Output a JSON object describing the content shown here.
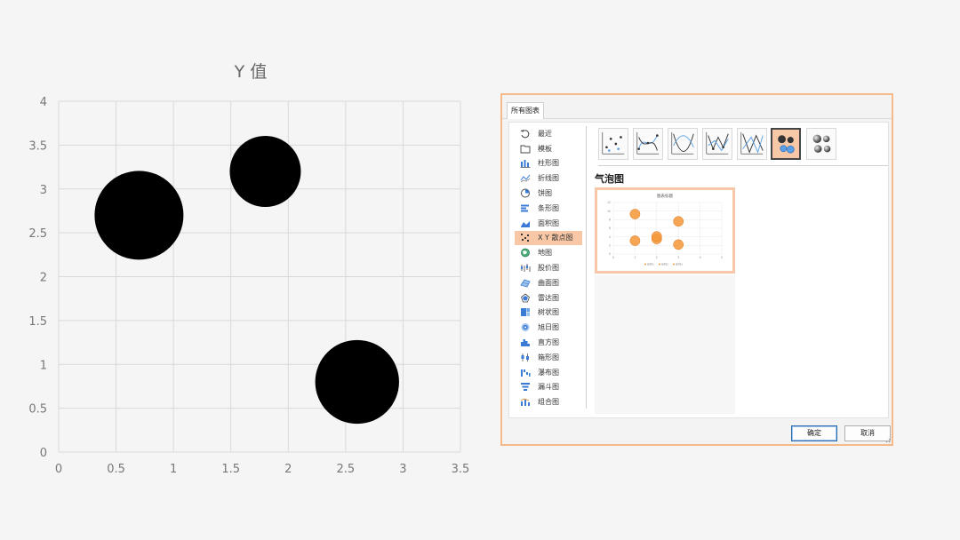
{
  "chart_data": {
    "type": "bubble",
    "title": "Y 值",
    "xlim": [
      0,
      3.5
    ],
    "ylim": [
      0,
      4
    ],
    "x_ticks": [
      "0",
      "0.5",
      "1",
      "1.5",
      "2",
      "2.5",
      "3",
      "3.5"
    ],
    "y_ticks": [
      "0",
      "0.5",
      "1",
      "1.5",
      "2",
      "2.5",
      "3",
      "3.5",
      "4"
    ],
    "grid": true,
    "series": [
      {
        "color": "#000000",
        "points": [
          {
            "x": 0.7,
            "y": 2.7,
            "size": 1.0
          },
          {
            "x": 1.8,
            "y": 3.2,
            "size": 0.64
          },
          {
            "x": 2.6,
            "y": 0.8,
            "size": 0.89
          }
        ]
      }
    ]
  },
  "dialog": {
    "tab_label": "所有图表",
    "selected_type_title": "气泡图",
    "accent_color": "#f5b98a",
    "sidebar": [
      {
        "label": "最近",
        "icon": "recent-icon",
        "selected": false
      },
      {
        "label": "模板",
        "icon": "folder-icon",
        "selected": false
      },
      {
        "label": "柱形图",
        "icon": "column-chart-icon",
        "selected": false
      },
      {
        "label": "折线图",
        "icon": "line-chart-icon",
        "selected": false
      },
      {
        "label": "饼图",
        "icon": "pie-chart-icon",
        "selected": false
      },
      {
        "label": "条形图",
        "icon": "bar-chart-icon",
        "selected": false
      },
      {
        "label": "面积图",
        "icon": "area-chart-icon",
        "selected": false
      },
      {
        "label": "X Y 散点图",
        "icon": "scatter-chart-icon",
        "selected": true
      },
      {
        "label": "地图",
        "icon": "map-chart-icon",
        "selected": false
      },
      {
        "label": "股价图",
        "icon": "stock-chart-icon",
        "selected": false
      },
      {
        "label": "曲面图",
        "icon": "surface-chart-icon",
        "selected": false
      },
      {
        "label": "雷达图",
        "icon": "radar-chart-icon",
        "selected": false
      },
      {
        "label": "树状图",
        "icon": "treemap-chart-icon",
        "selected": false
      },
      {
        "label": "旭日图",
        "icon": "sunburst-chart-icon",
        "selected": false
      },
      {
        "label": "直方图",
        "icon": "histogram-chart-icon",
        "selected": false
      },
      {
        "label": "箱形图",
        "icon": "box-chart-icon",
        "selected": false
      },
      {
        "label": "瀑布图",
        "icon": "waterfall-chart-icon",
        "selected": false
      },
      {
        "label": "漏斗图",
        "icon": "funnel-chart-icon",
        "selected": false
      },
      {
        "label": "组合图",
        "icon": "combo-chart-icon",
        "selected": false
      }
    ],
    "subtypes": [
      {
        "icon": "scatter-markers-icon",
        "selected": false
      },
      {
        "icon": "scatter-smooth-markers-icon",
        "selected": false
      },
      {
        "icon": "scatter-smooth-lines-icon",
        "selected": false
      },
      {
        "icon": "scatter-straight-markers-icon",
        "selected": false
      },
      {
        "icon": "scatter-straight-lines-icon",
        "selected": false
      },
      {
        "icon": "bubble-icon",
        "selected": true
      },
      {
        "icon": "bubble-3d-icon",
        "selected": false
      }
    ],
    "preview": {
      "title": "图表标题",
      "color": "#f59a3c",
      "y_ticks": [
        "0",
        "2",
        "4",
        "6",
        "8",
        "10",
        "12"
      ],
      "x_ticks": [
        "0",
        "1",
        "2",
        "3",
        "4",
        "5"
      ],
      "legend": [
        "系列1",
        "系列2",
        "系列3"
      ],
      "points": [
        {
          "x": 1,
          "y": 9.3
        },
        {
          "x": 1,
          "y": 3.1
        },
        {
          "x": 2,
          "y": 3.5
        },
        {
          "x": 2,
          "y": 4.1
        },
        {
          "x": 3,
          "y": 7.6
        },
        {
          "x": 3,
          "y": 2.2
        }
      ]
    },
    "ok_label": "确定",
    "cancel_label": "取消"
  }
}
